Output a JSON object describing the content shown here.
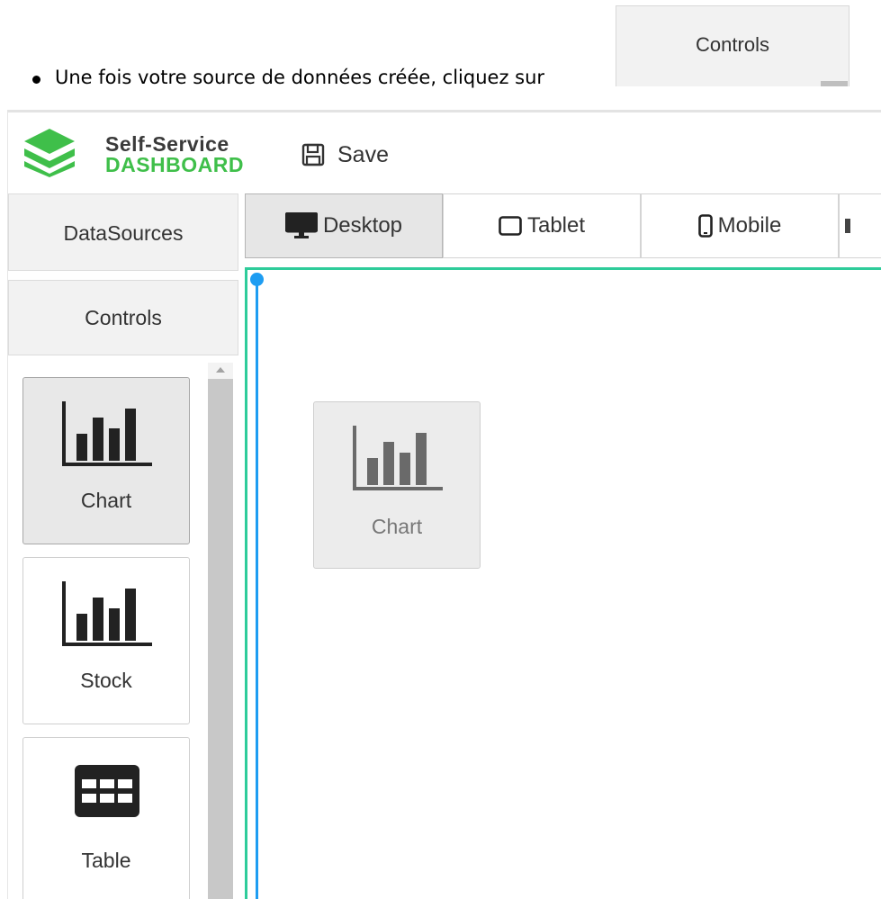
{
  "instruction": {
    "text": "Une fois votre source de données créée, cliquez sur",
    "callout_label": "Controls"
  },
  "app": {
    "logo": {
      "line1": "Self-Service",
      "line2": "DASHBOARD",
      "green": "#3fbf4a",
      "dark": "#3a3a3a"
    },
    "toolbar": {
      "save_label": "Save",
      "save_icon": "floppy-disk-icon"
    },
    "sidebar": {
      "datasources_label": "DataSources",
      "controls_label": "Controls",
      "items": [
        {
          "label": "Chart",
          "icon": "bar-chart-icon",
          "selected": true
        },
        {
          "label": "Stock",
          "icon": "bar-chart-icon",
          "selected": false
        },
        {
          "label": "Table",
          "icon": "table-grid-icon",
          "selected": false
        }
      ]
    },
    "device_tabs": [
      {
        "label": "Desktop",
        "icon": "desktop-icon",
        "active": true
      },
      {
        "label": "Tablet",
        "icon": "tablet-icon",
        "active": false
      },
      {
        "label": "Mobile",
        "icon": "mobile-icon",
        "active": false
      }
    ],
    "canvas": {
      "widget_label": "Chart",
      "border_color": "#2ecc9a",
      "guide_color": "#1e9df2"
    }
  }
}
